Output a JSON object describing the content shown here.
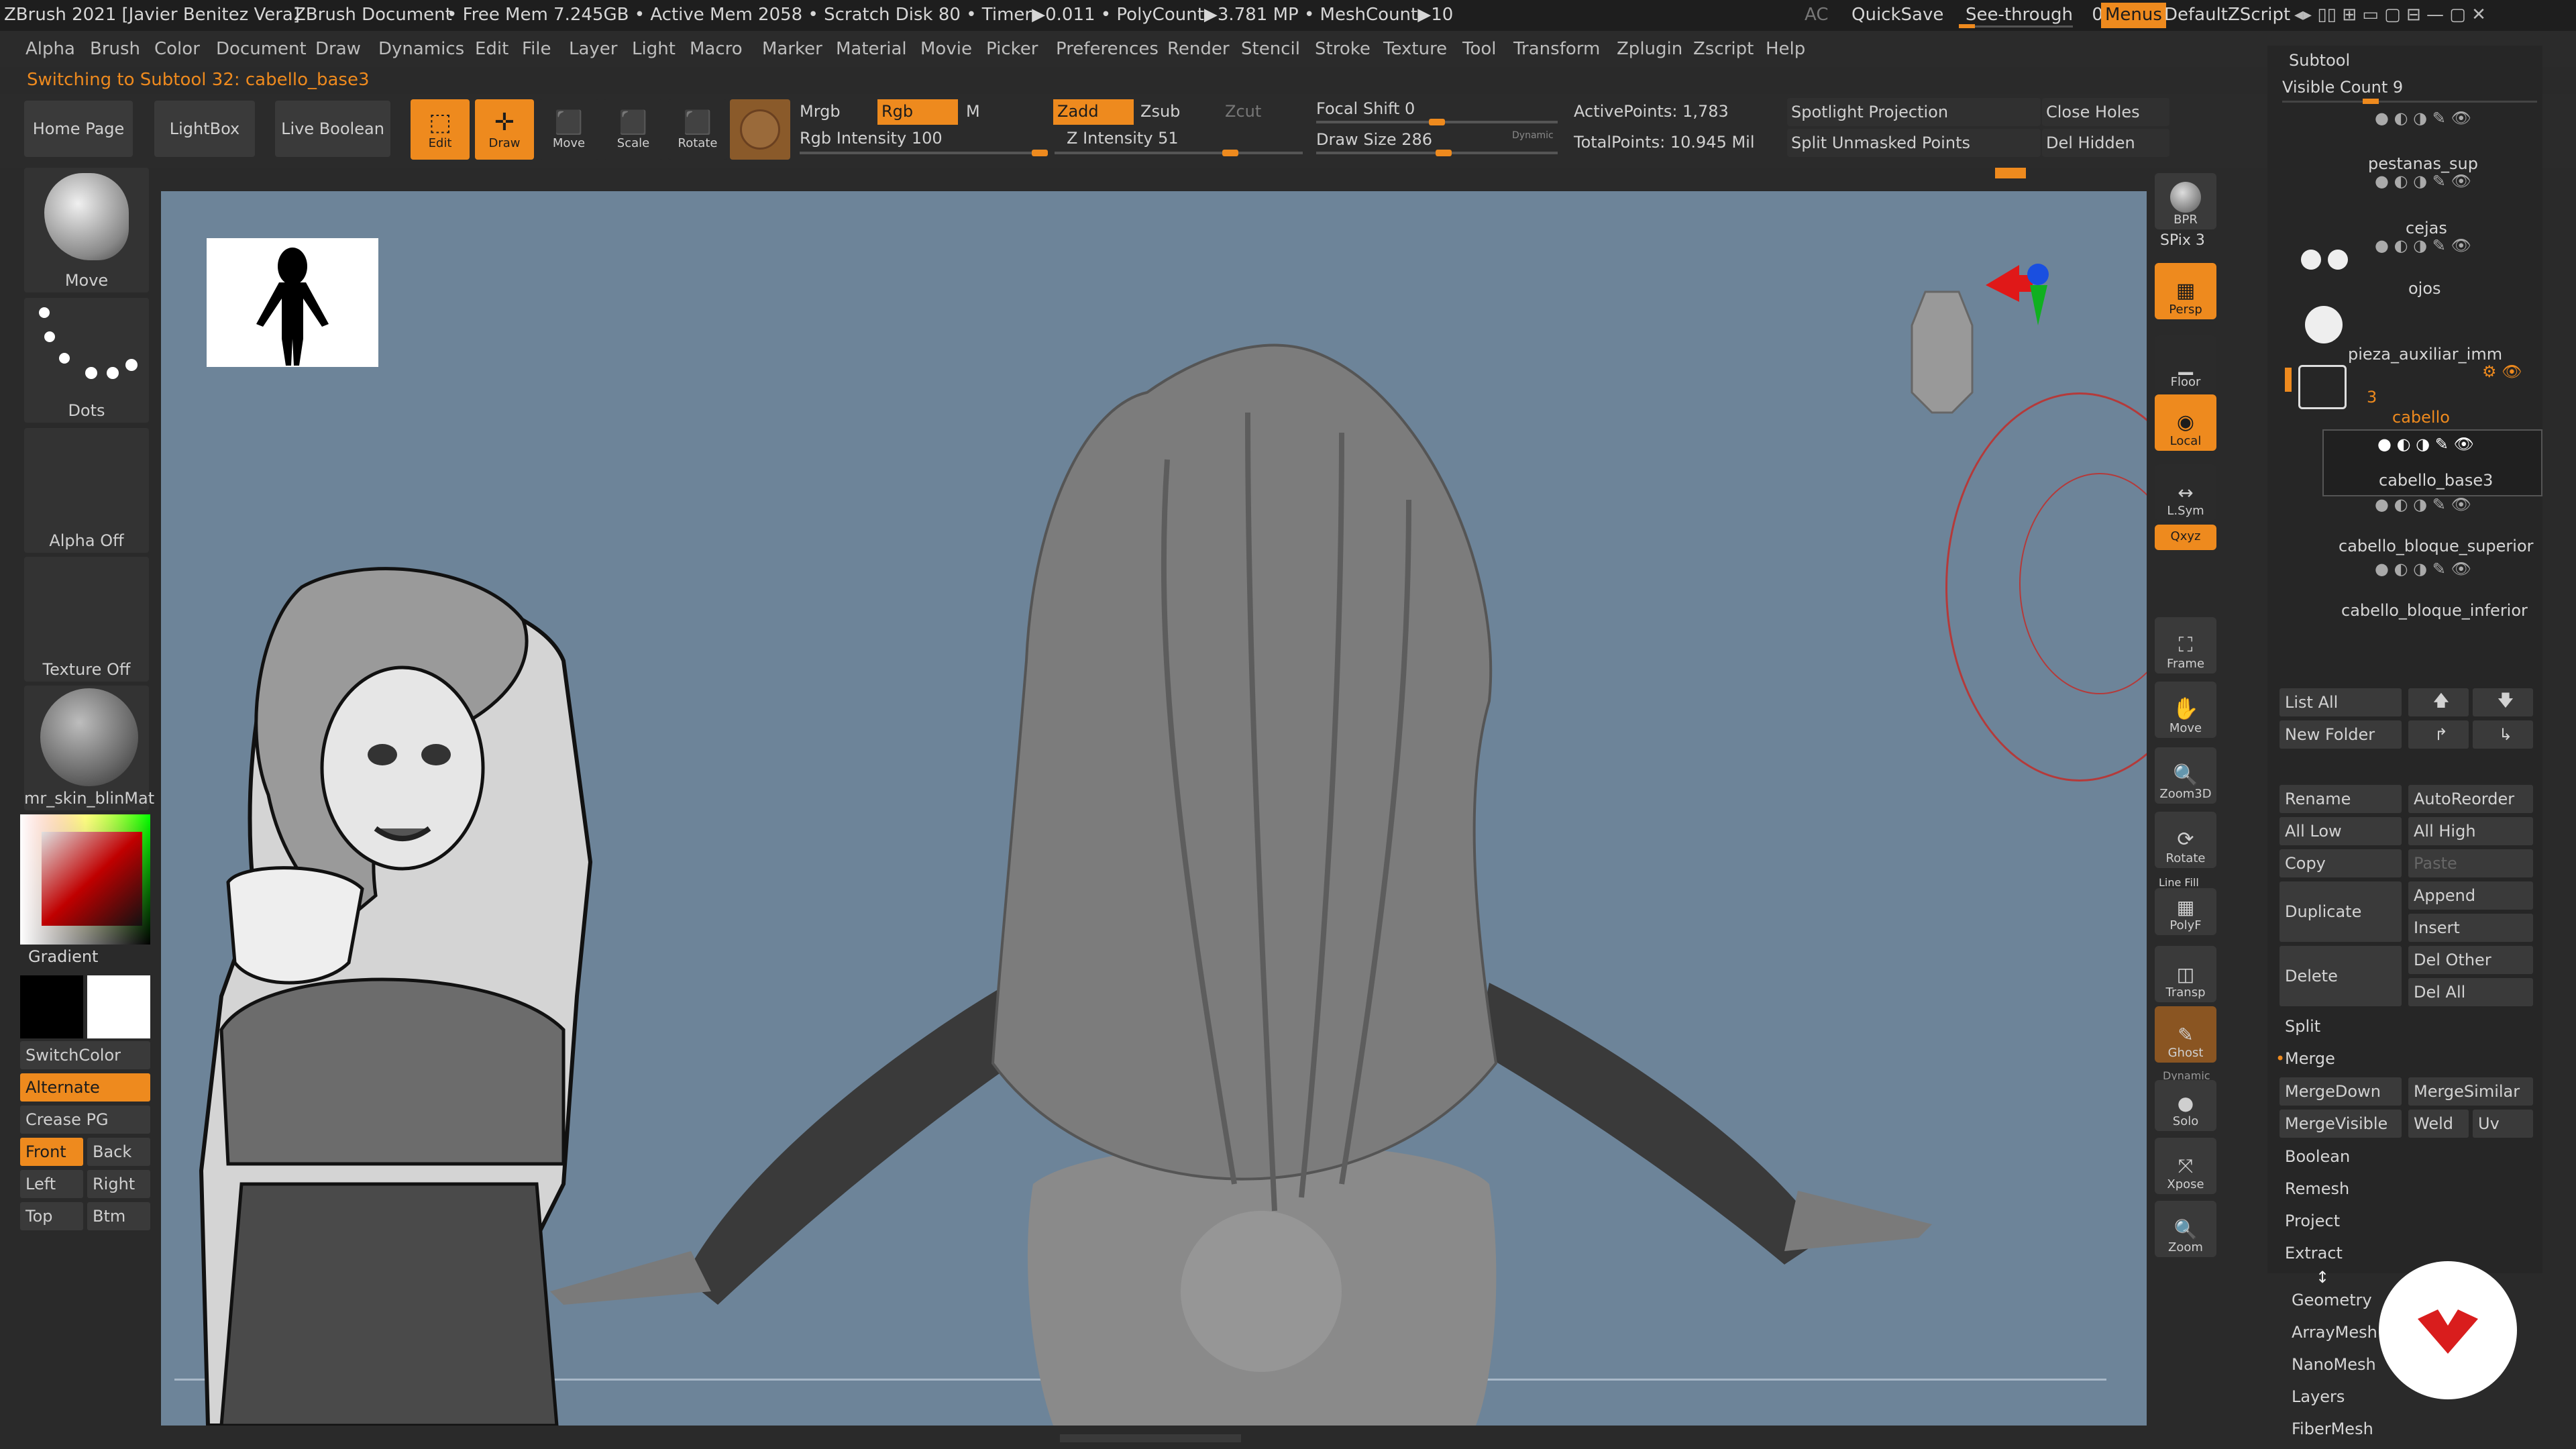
{
  "titlebar": {
    "app": "ZBrush 2021 [Javier Benitez Vera]",
    "doc": "ZBrush Document",
    "stats": "• Free Mem 7.245GB • Active Mem 2058 • Scratch Disk 80 • Timer▶0.011 • PolyCount▶3.781 MP • MeshCount▶10",
    "ac": "AC",
    "quicksave": "QuickSave",
    "seethrough": "See-through",
    "seethrough_value": "0",
    "menus": "Menus",
    "script": "DefaultZScript"
  },
  "menubar": [
    "Alpha",
    "Brush",
    "Color",
    "Document",
    "Draw",
    "Dynamics",
    "Edit",
    "File",
    "Layer",
    "Light",
    "Macro",
    "Marker",
    "Material",
    "Movie",
    "Picker",
    "Preferences",
    "Render",
    "Stencil",
    "Stroke",
    "Texture",
    "Tool",
    "Transform",
    "Zplugin",
    "Zscript",
    "Help"
  ],
  "status": "Switching to Subtool 32:  cabello_base3",
  "toolbar": {
    "home": "Home Page",
    "lightbox": "LightBox",
    "liveboolean": "Live Boolean",
    "edit": "Edit",
    "draw": "Draw",
    "move": "Move",
    "scale": "Scale",
    "rotate": "Rotate",
    "mrgb": "Mrgb",
    "rgb": "Rgb",
    "m": "M",
    "rgb_intensity": "Rgb Intensity 100",
    "zadd": "Zadd",
    "zsub": "Zsub",
    "zcut": "Zcut",
    "z_intensity": "Z Intensity 51",
    "focal_shift": "Focal Shift 0",
    "draw_size": "Draw Size 286",
    "dynamic": "Dynamic",
    "active_points": "ActivePoints: 1,783",
    "total_points": "TotalPoints: 10.945 Mil",
    "spotlight": "Spotlight Projection",
    "split_unmasked": "Split Unmasked Points",
    "close_holes": "Close Holes",
    "del_hidden": "Del Hidden"
  },
  "left_shelf": {
    "brush": "Move",
    "stroke": "Dots",
    "alpha": "Alpha Off",
    "texture": "Texture Off",
    "material": "mr_skin_blinMat",
    "gradient": "Gradient",
    "switchcolor": "SwitchColor",
    "alternate": "Alternate",
    "creasepg": "Crease PG",
    "front": "Front",
    "back": "Back",
    "left": "Left",
    "right": "Right",
    "top": "Top",
    "btm": "Btm"
  },
  "right_tools": {
    "bpr": "BPR",
    "spix": "SPix 3",
    "persp": "Persp",
    "floor": "Floor",
    "local": "Local",
    "lsym": "L.Sym",
    "xyz": "Qxyz",
    "frame": "Frame",
    "move": "Move",
    "zoom3d": "Zoom3D",
    "rotate": "Rotate",
    "linefill": "Line Fill",
    "polyf": "PolyF",
    "transp": "Transp",
    "ghost": "Ghost",
    "dynamic": "Dynamic",
    "solo": "Solo",
    "xpose": "Xpose",
    "zoom": "Zoom"
  },
  "subtool": {
    "title": "Subtool",
    "visible_count": "Visible Count 9",
    "items": [
      "pestanas_sup",
      "cejas",
      "ojos",
      "pieza_auxiliar_imm",
      "cabello",
      "cabello_base3",
      "cabello_bloque_superior",
      "cabello_bloque_inferior"
    ],
    "folder_count": "3",
    "list_all": "List All",
    "new_folder": "New Folder",
    "rename": "Rename",
    "autoreorder": "AutoReorder",
    "all_low": "All Low",
    "all_high": "All High",
    "copy": "Copy",
    "paste": "Paste",
    "duplicate": "Duplicate",
    "append": "Append",
    "insert": "Insert",
    "delete": "Delete",
    "del_other": "Del Other",
    "del_all": "Del All",
    "split": "Split",
    "merge": "Merge",
    "mergedown": "MergeDown",
    "mergesimilar": "MergeSimilar",
    "mergevisible": "MergeVisible",
    "weld": "Weld",
    "uv": "Uv",
    "boolean": "Boolean",
    "remesh": "Remesh",
    "project": "Project",
    "extract": "Extract",
    "geometry": "Geometry",
    "arraymesh": "ArrayMesh",
    "nanomesh": "NanoMesh",
    "layers": "Layers",
    "fibermesh": "FiberMesh"
  },
  "colors": {
    "accent": "#ee8a1e",
    "canvas": "#6d8499",
    "panel": "#262626",
    "logo": "#d91d1d"
  }
}
